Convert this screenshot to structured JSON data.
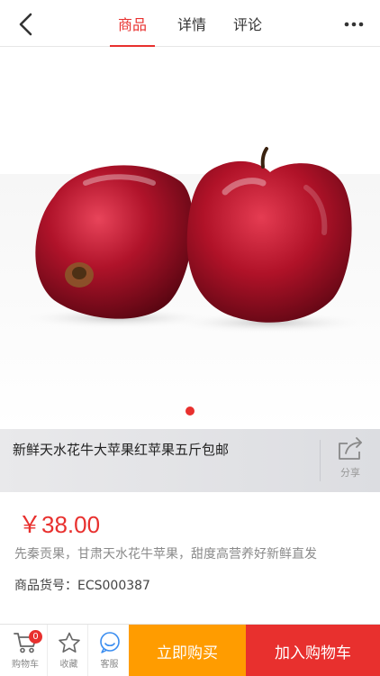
{
  "header": {
    "tabs": [
      {
        "label": "商品",
        "active": true
      },
      {
        "label": "详情",
        "active": false
      },
      {
        "label": "评论",
        "active": false
      }
    ],
    "back_icon": "chevron-left-icon",
    "more_icon": "more-dots-icon"
  },
  "gallery": {
    "image_subject": "two red apples",
    "carousel_dots": 1,
    "active_dot": 1
  },
  "product": {
    "title": "新鲜天水花牛大苹果红苹果五斤包邮",
    "share_label": "分享",
    "price": "￥38.00",
    "description": "先秦贡果，甘肃天水花牛苹果，甜度高营养好新鲜直发",
    "sku": "商品货号：ECS000387"
  },
  "bottom_bar": {
    "cart_label": "购物车",
    "cart_count": "0",
    "favorite_label": "收藏",
    "service_label": "客服",
    "buy_now_label": "立即购买",
    "add_to_cart_label": "加入购物车"
  },
  "colors": {
    "accent": "#e8302e",
    "buy_button": "#ff9c00",
    "cart_button": "#e8302e"
  }
}
